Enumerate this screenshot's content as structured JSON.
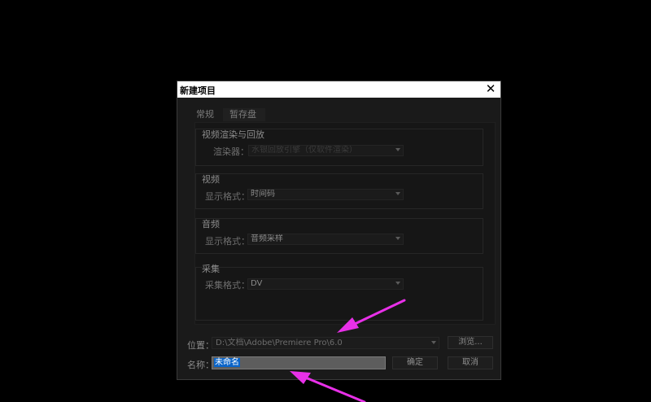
{
  "dialog": {
    "title": "新建项目",
    "close_glyph": "✕"
  },
  "tabs": [
    {
      "label": "常规"
    },
    {
      "label": "暂存盘"
    }
  ],
  "groups": {
    "render": {
      "title": "视频渲染与回放",
      "label": "渲染器：",
      "value": "水银回放引擎（仅软件渲染）"
    },
    "video": {
      "title": "视频",
      "label": "显示格式：",
      "value": "时间码"
    },
    "audio": {
      "title": "音频",
      "label": "显示格式：",
      "value": "音频采样"
    },
    "capture": {
      "title": "采集",
      "label": "采集格式：",
      "value": "DV"
    }
  },
  "location": {
    "label": "位置：",
    "path": "D:\\文档\\Adobe\\Premiere Pro\\6.0",
    "browse_label": "浏览..."
  },
  "name": {
    "label": "名称：",
    "value": "未命名"
  },
  "buttons": {
    "ok_label": "确定",
    "cancel_label": "取消"
  },
  "colors": {
    "annotation_arrow": "#e830e8",
    "selection": "#0a64c8"
  }
}
